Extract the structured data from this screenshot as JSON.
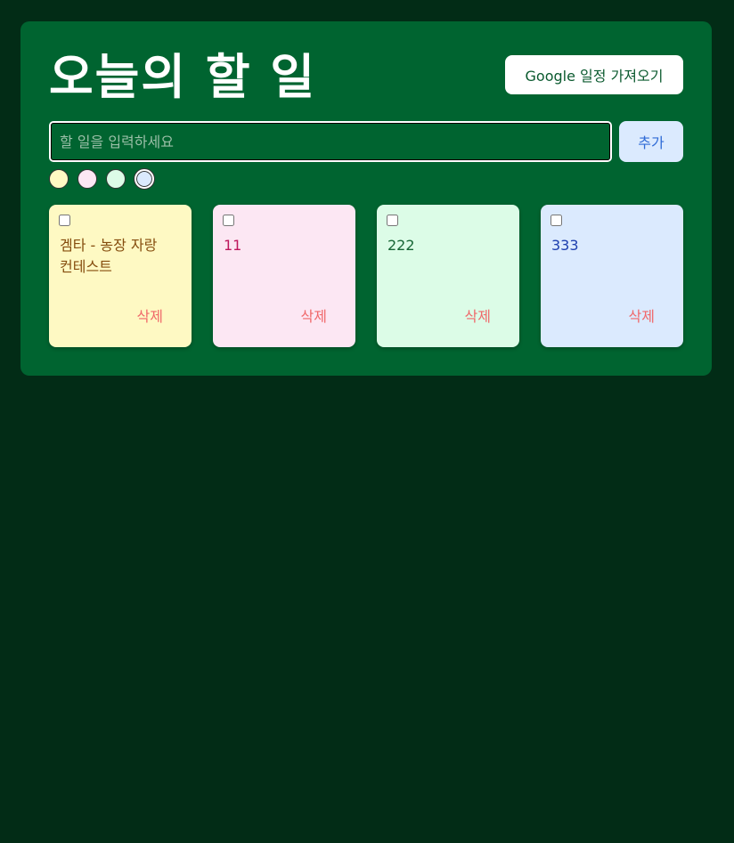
{
  "header": {
    "title": "오늘의 할 일",
    "google_button_label": "Google 일정 가져오기"
  },
  "input": {
    "placeholder": "할 일을 입력하세요",
    "value": "",
    "add_button_label": "추가"
  },
  "colors": {
    "page_background": "#022c16",
    "panel_background": "#006430"
  },
  "color_swatches": [
    {
      "color": "#fef9c3",
      "selected": false
    },
    {
      "color": "#fce7f3",
      "selected": false
    },
    {
      "color": "#dcfce7",
      "selected": false
    },
    {
      "color": "#dbeafe",
      "selected": true
    }
  ],
  "notes": [
    {
      "text": "겜타 - 농장 자랑 컨테스트",
      "checked": false,
      "background": "#fef9c3",
      "text_color": "#854d0e",
      "delete_label": "삭제"
    },
    {
      "text": "11",
      "checked": false,
      "background": "#fce7f3",
      "text_color": "#be185d",
      "delete_label": "삭제"
    },
    {
      "text": "222",
      "checked": false,
      "background": "#dcfce7",
      "text_color": "#166534",
      "delete_label": "삭제"
    },
    {
      "text": "333",
      "checked": false,
      "background": "#dbeafe",
      "text_color": "#1e40af",
      "delete_label": "삭제"
    }
  ]
}
